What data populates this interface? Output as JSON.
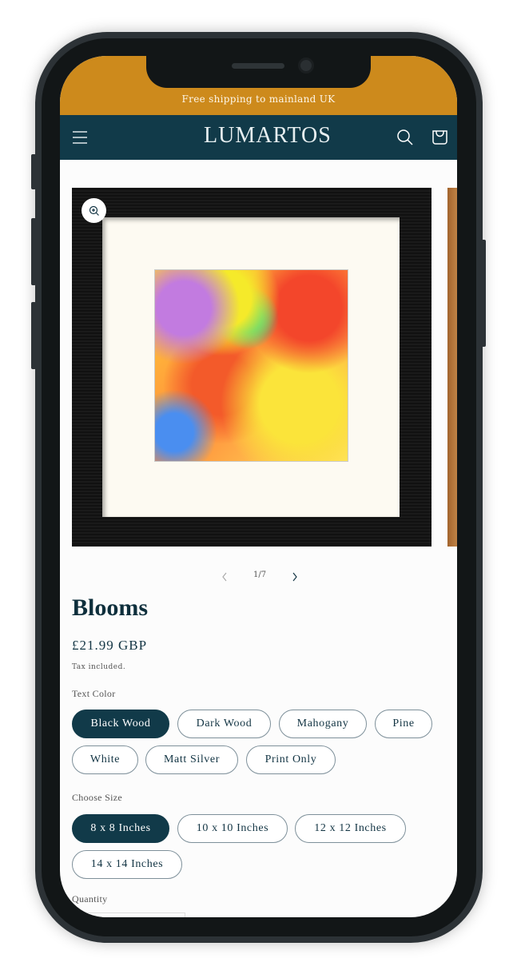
{
  "announcement": "Free shipping to mainland UK",
  "header": {
    "logo": "LUMARTOS",
    "menu_icon": "hamburger-icon",
    "search_icon": "search-icon",
    "cart_icon": "cart-icon"
  },
  "colors": {
    "announcement_bg": "#cd8a1c",
    "header_bg": "#113a49",
    "selected_pill": "#113a49"
  },
  "gallery": {
    "pager": "1/7"
  },
  "product": {
    "title": "Blooms",
    "price": "£21.99 GBP",
    "tax_note": "Tax included."
  },
  "options": {
    "color_label": "Text Color",
    "colors": [
      {
        "label": "Black Wood",
        "selected": true
      },
      {
        "label": "Dark Wood"
      },
      {
        "label": "Mahogany"
      },
      {
        "label": "Pine"
      },
      {
        "label": "White"
      },
      {
        "label": "Matt Silver"
      },
      {
        "label": "Print Only"
      }
    ],
    "size_label": "Choose Size",
    "sizes": [
      {
        "label": "8 x 8 Inches",
        "selected": true
      },
      {
        "label": "10 x 10 Inches"
      },
      {
        "label": "12 x 12 Inches"
      },
      {
        "label": "14 x 14 Inches"
      }
    ],
    "quantity_label": "Quantity"
  }
}
